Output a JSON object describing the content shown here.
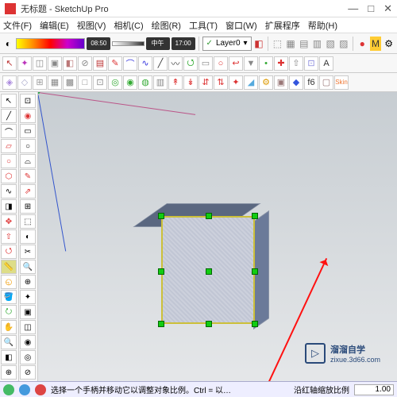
{
  "window": {
    "title": "无标题 - SketchUp Pro",
    "min": "—",
    "max": "□",
    "close": "✕"
  },
  "menu": {
    "file": "文件(F)",
    "edit": "编辑(E)",
    "view": "视图(V)",
    "camera": "相机(C)",
    "draw": "绘图(R)",
    "tools": "工具(T)",
    "window": "窗口(W)",
    "ext": "扩展程序",
    "help": "帮助(H)"
  },
  "toolbar1": {
    "time_start": "08:50",
    "time_mid": "中午",
    "time_end": "17:00",
    "layer_check": "✓",
    "layer_name": "Layer0",
    "drop": "▾"
  },
  "status": {
    "hint": "选择一个手柄并移动它以调整对象比例。Ctrl = 以…",
    "field_label": "沿红轴缩放比例",
    "field_value": "1.00"
  },
  "watermark": {
    "brand": "溜溜自学",
    "url": "zixue.3d66.com",
    "play": "▷"
  }
}
